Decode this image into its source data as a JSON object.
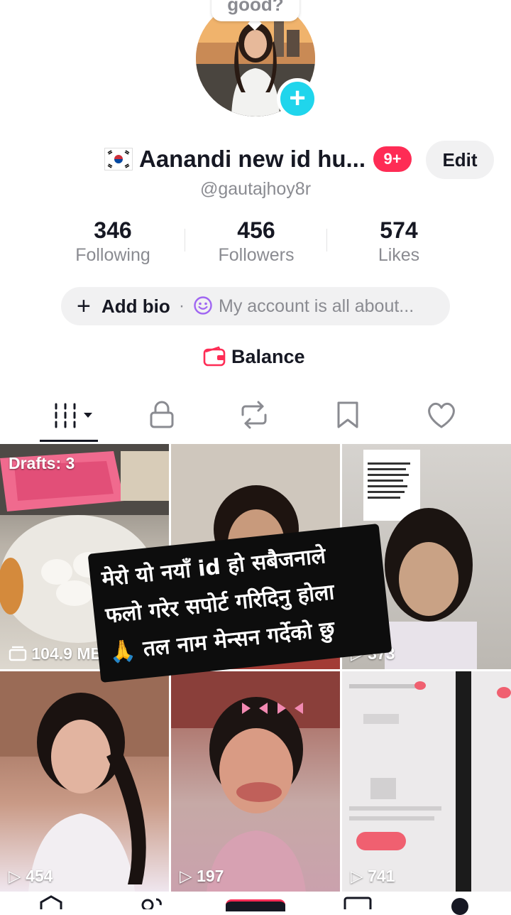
{
  "profile": {
    "bubble_text": "good?",
    "display_name": "Aanandi new id hu...",
    "notification_badge": "9+",
    "edit_label": "Edit",
    "username": "@gautajhoy8r"
  },
  "stats": [
    {
      "value": "346",
      "label": "Following"
    },
    {
      "value": "456",
      "label": "Followers"
    },
    {
      "value": "574",
      "label": "Likes"
    }
  ],
  "bio": {
    "add_label": "Add bio",
    "separator": "·",
    "placeholder": "My account is all about..."
  },
  "balance_label": "Balance",
  "tabs": [
    "videos-grid",
    "private",
    "reposts",
    "favorites",
    "liked"
  ],
  "grid": {
    "drafts_label": "Drafts: 3",
    "drafts_size": "104.9 MB",
    "counts": [
      "373",
      "454",
      "197",
      "741"
    ],
    "overlay_lines": [
      "मेरो यो नयाँ id हो सबैजनाले",
      "फलो गरेर सपोर्ट गरिदिनु होला",
      "🙏 तल नाम मेन्सन गर्देको छु"
    ]
  },
  "colors": {
    "accent_red": "#fe2c55",
    "plus_cyan": "#20d5ec",
    "muted_text": "#8a8b91"
  }
}
